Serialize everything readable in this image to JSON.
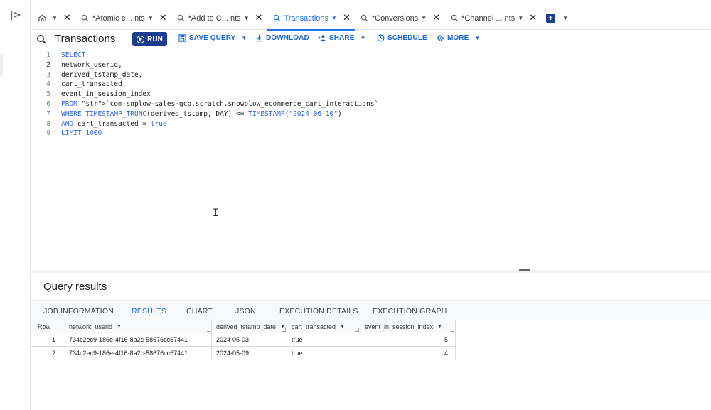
{
  "tabs": [
    {
      "label": "",
      "icon": "home-icon",
      "type": "home"
    },
    {
      "label": "*Atomic e... nts",
      "icon": "query-icon"
    },
    {
      "label": "*Add to C... nts",
      "icon": "query-icon"
    },
    {
      "label": "Transactions",
      "icon": "query-icon",
      "active": true
    },
    {
      "label": "*Conversions",
      "icon": "query-icon"
    },
    {
      "label": "*Channel ... nts",
      "icon": "query-icon"
    }
  ],
  "toolbar": {
    "title": "Transactions",
    "run": "RUN",
    "save_query": "SAVE QUERY",
    "download": "DOWNLOAD",
    "share": "SHARE",
    "schedule": "SCHEDULE",
    "more": "MORE"
  },
  "editor": {
    "line_numbers": [
      "1",
      "2",
      "3",
      "4",
      "5",
      "6",
      "7",
      "8",
      "9"
    ],
    "lines": [
      "SELECT",
      "network_userid,",
      "derived_tstamp_date,",
      "cart_transacted,",
      "event_in_session_index",
      "FROM `com-snplow-sales-gcp.scratch.snowplow_ecommerce_cart_interactions`",
      "WHERE TIMESTAMP_TRUNC(derived_tstamp, DAY) <= TIMESTAMP(\"2024-06-10\")",
      "AND cart_transacted = true",
      "LIMIT 1000"
    ]
  },
  "results": {
    "title": "Query results",
    "tabs": [
      "JOB INFORMATION",
      "RESULTS",
      "CHART",
      "JSON",
      "EXECUTION DETAILS",
      "EXECUTION GRAPH"
    ],
    "active_tab": "RESULTS",
    "columns": [
      "Row",
      "network_userid",
      "derived_tstamp_date",
      "cart_transacted",
      "event_in_session_index"
    ],
    "rows": [
      [
        "1",
        "734c2ec9-186e-4f16-8a2c-58676cc67441",
        "2024-05-03",
        "true",
        "5"
      ],
      [
        "2",
        "734c2ec9-186e-4f16-8a2c-58676cc67441",
        "2024-05-09",
        "true",
        "4"
      ]
    ]
  },
  "colors": {
    "accent": "#1a73e8",
    "run_button": "#1a3d8f",
    "keyword": "#3367d6"
  }
}
